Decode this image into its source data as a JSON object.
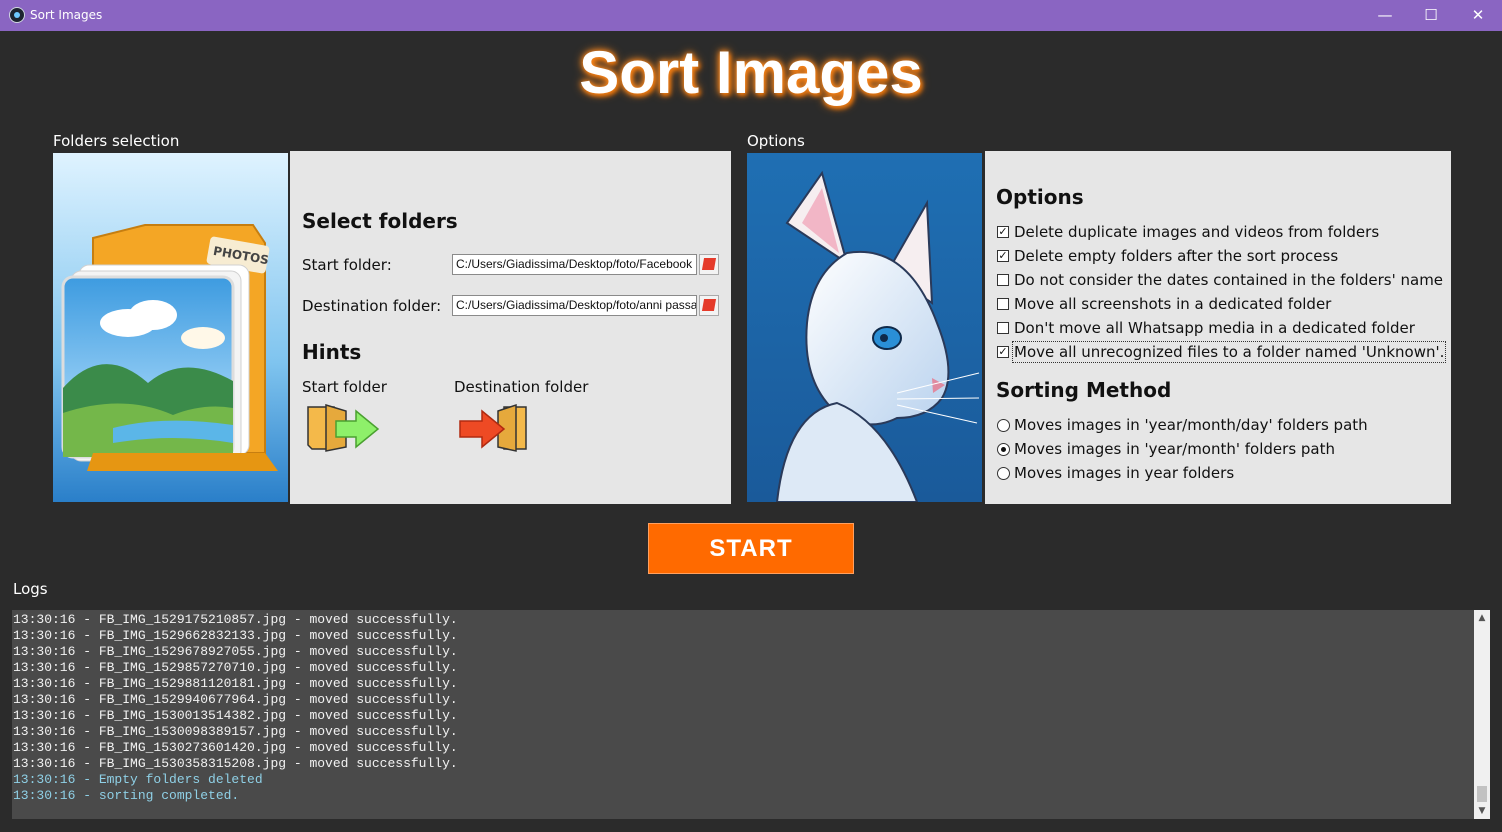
{
  "window": {
    "title": "Sort Images",
    "min": "—",
    "max": "☐",
    "close": "✕"
  },
  "app_title": "Sort Images",
  "folders": {
    "section_label": "Folders selection",
    "heading": "Select folders",
    "start_label": "Start folder:",
    "start_value": "C:/Users/Giadissima/Desktop/foto/Facebook",
    "dest_label": "Destination folder:",
    "dest_value": "C:/Users/Giadissima/Desktop/foto/anni passati",
    "hints_heading": "Hints",
    "hint_start": "Start folder",
    "hint_dest": "Destination folder",
    "folder_image_label": "PHOTOS"
  },
  "options": {
    "section_label": "Options",
    "heading": "Options",
    "items": [
      {
        "label": "Delete duplicate images and videos from folders",
        "checked": true
      },
      {
        "label": "Delete empty folders after the sort process",
        "checked": true
      },
      {
        "label": "Do not consider the dates contained in the folders' name",
        "checked": false
      },
      {
        "label": "Move all screenshots in a dedicated folder",
        "checked": false
      },
      {
        "label": "Don't move all Whatsapp media in a dedicated folder",
        "checked": false
      },
      {
        "label": "Move all unrecognized files to a folder named 'Unknown'.",
        "checked": true
      }
    ],
    "sorting_heading": "Sorting Method",
    "sorting": [
      {
        "label": "Moves images in 'year/month/day' folders path",
        "selected": false
      },
      {
        "label": "Moves images in 'year/month' folders path",
        "selected": true
      },
      {
        "label": "Moves images in year folders",
        "selected": false
      }
    ]
  },
  "start_button": "START",
  "logs": {
    "section_label": "Logs",
    "lines": [
      {
        "text": "13:30:16 - FB_IMG_1529175210857.jpg - moved successfully.",
        "kind": "normal"
      },
      {
        "text": "13:30:16 - FB_IMG_1529662832133.jpg - moved successfully.",
        "kind": "normal"
      },
      {
        "text": "13:30:16 - FB_IMG_1529678927055.jpg - moved successfully.",
        "kind": "normal"
      },
      {
        "text": "13:30:16 - FB_IMG_1529857270710.jpg - moved successfully.",
        "kind": "normal"
      },
      {
        "text": "13:30:16 - FB_IMG_1529881120181.jpg - moved successfully.",
        "kind": "normal"
      },
      {
        "text": "13:30:16 - FB_IMG_1529940677964.jpg - moved successfully.",
        "kind": "normal"
      },
      {
        "text": "13:30:16 - FB_IMG_1530013514382.jpg - moved successfully.",
        "kind": "normal"
      },
      {
        "text": "13:30:16 - FB_IMG_1530098389157.jpg - moved successfully.",
        "kind": "normal"
      },
      {
        "text": "13:30:16 - FB_IMG_1530273601420.jpg - moved successfully.",
        "kind": "normal"
      },
      {
        "text": "13:30:16 - FB_IMG_1530358315208.jpg - moved successfully.",
        "kind": "normal"
      },
      {
        "text": "13:30:16 - Empty folders deleted",
        "kind": "info"
      },
      {
        "text": "13:30:16 - sorting completed.",
        "kind": "info"
      }
    ]
  },
  "colors": {
    "titlebar": "#8a65c2",
    "accent": "#ff6a00",
    "background": "#2b2b2b",
    "panel": "#e6e6e6",
    "log_info": "#8fd0e6"
  }
}
